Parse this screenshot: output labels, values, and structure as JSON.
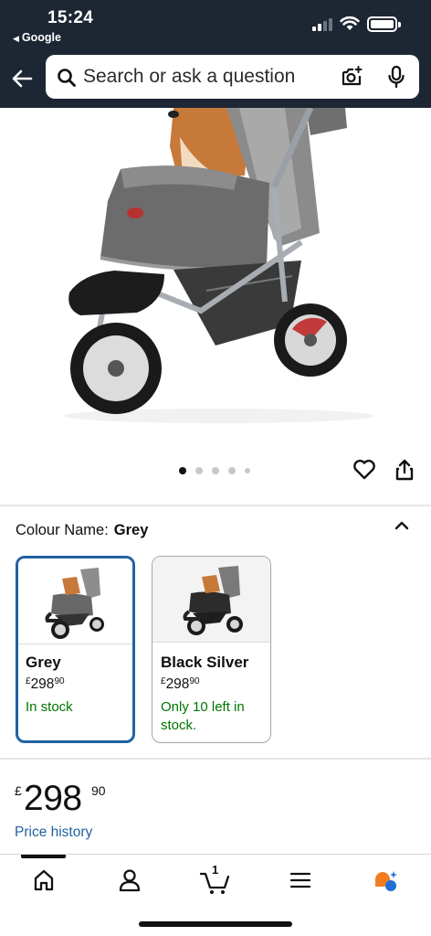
{
  "status_bar": {
    "time": "15:24",
    "back_app_label": "Google"
  },
  "header": {
    "search_placeholder": "Search or ask a question",
    "icons": [
      "back-arrow-icon",
      "search-icon",
      "camera-icon",
      "microphone-icon"
    ]
  },
  "gallery": {
    "image_count": 5,
    "active_index": 0,
    "icons": [
      "heart-icon",
      "share-icon"
    ]
  },
  "colour": {
    "label": "Colour Name:",
    "selected_value": "Grey",
    "options": [
      {
        "name": "Grey",
        "currency": "£",
        "whole": "298",
        "fraction": "90",
        "stock": "In stock",
        "selected": true
      },
      {
        "name": "Black Silver",
        "currency": "£",
        "whole": "298",
        "fraction": "90",
        "stock": "Only 10 left in stock.",
        "selected": false
      }
    ]
  },
  "price": {
    "currency": "£",
    "whole": "298",
    "fraction": "90",
    "history_link": "Price history"
  },
  "tabbar": {
    "cart_count": "1",
    "tabs": [
      "home-icon",
      "account-icon",
      "cart-icon",
      "menu-icon",
      "rufus-icon"
    ]
  },
  "colors": {
    "header_bg": "#1d2733",
    "selected_border": "#2162a1",
    "link": "#2162a1",
    "in_stock": "#007600"
  }
}
